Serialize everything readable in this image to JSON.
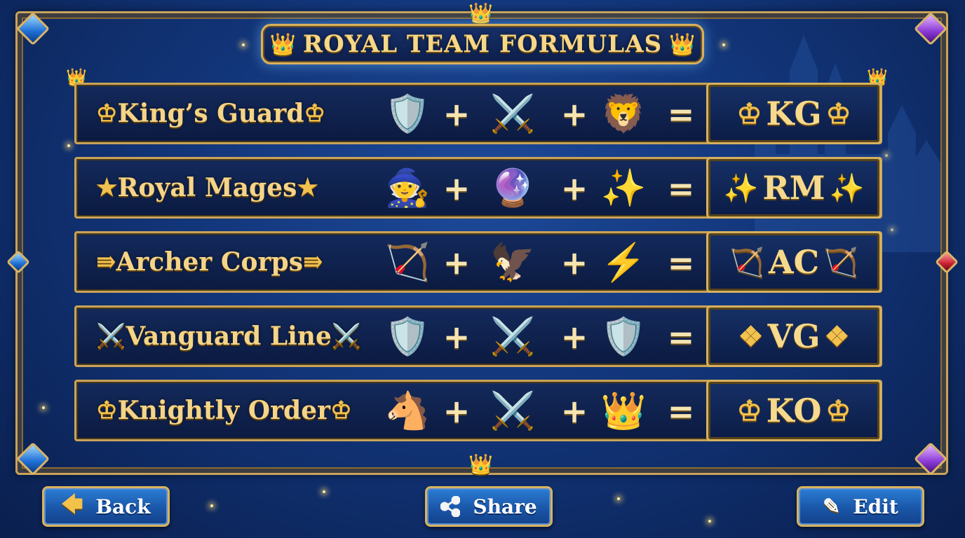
{
  "title": "ROYAL TEAM FORMULAS",
  "colors": {
    "gold": "#f4d488",
    "panel": "#0b1a40",
    "frame": "#c9a35a",
    "button": "#1a56a8"
  },
  "rows": [
    {
      "name": "King’s Guard",
      "deco": "♔",
      "icons": [
        {
          "glyph": "🛡️",
          "name": "shield-icon"
        },
        {
          "glyph": "⚔️",
          "name": "crossed-swords-icon"
        },
        {
          "glyph": "🦁",
          "name": "lion-icon"
        }
      ],
      "result": "KG",
      "result_deco": "♔"
    },
    {
      "name": "Royal Mages",
      "deco": "★",
      "icons": [
        {
          "glyph": "🧙",
          "name": "wizard-icon"
        },
        {
          "glyph": "🔮",
          "name": "crystal-ball-icon"
        },
        {
          "glyph": "✨",
          "name": "sparkles-icon"
        }
      ],
      "result": "RM",
      "result_deco": "✨"
    },
    {
      "name": "Archer Corps",
      "deco": "⇛",
      "icons": [
        {
          "glyph": "🏹",
          "name": "bow-icon"
        },
        {
          "glyph": "🦅",
          "name": "eagle-icon"
        },
        {
          "glyph": "⚡",
          "name": "lightning-icon"
        }
      ],
      "result": "AC",
      "result_deco": "🏹"
    },
    {
      "name": "Vanguard Line",
      "deco": "⚔️",
      "icons": [
        {
          "glyph": "🛡️",
          "name": "shield-icon"
        },
        {
          "glyph": "⚔️",
          "name": "crossed-swords-icon"
        },
        {
          "glyph": "🛡️",
          "name": "shield-icon"
        }
      ],
      "result": "VG",
      "result_deco": "❖"
    },
    {
      "name": "Knightly Order",
      "deco": "♔",
      "icons": [
        {
          "glyph": "🐴",
          "name": "horse-icon"
        },
        {
          "glyph": "⚔️",
          "name": "crossed-swords-icon"
        },
        {
          "glyph": "👑",
          "name": "crown-icon"
        }
      ],
      "result": "KO",
      "result_deco": "♔"
    }
  ],
  "operators": {
    "plus": "+",
    "equals": "="
  },
  "buttons": {
    "back": {
      "label": "Back",
      "icon": "🡄"
    },
    "share": {
      "label": "Share",
      "icon": "⋖"
    },
    "edit": {
      "label": "Edit",
      "icon": "✎"
    }
  }
}
